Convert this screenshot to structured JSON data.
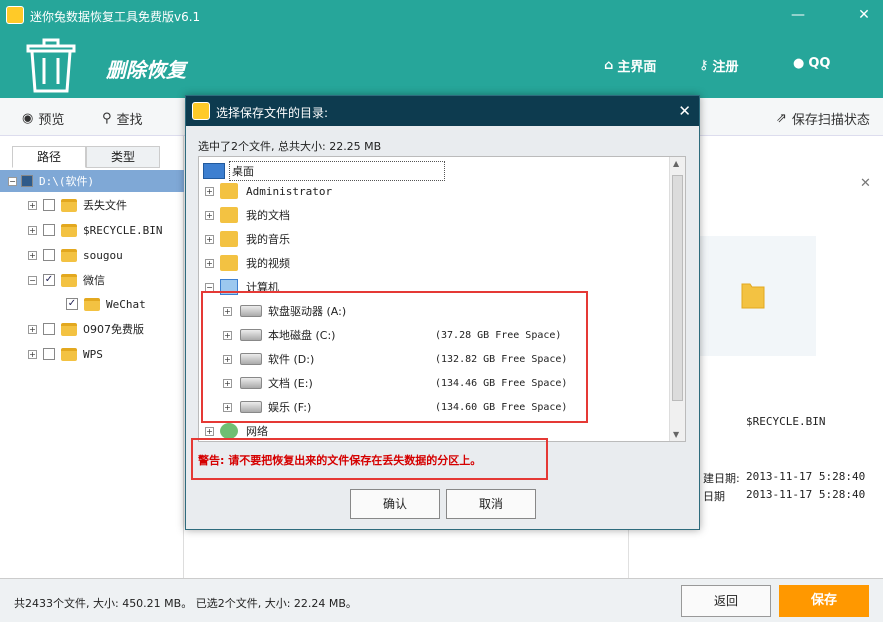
{
  "app": {
    "title": "迷你兔数据恢复工具免费版v6.1",
    "minimize": "—",
    "close": "✕"
  },
  "header": {
    "mode": "删除恢复",
    "nav": [
      {
        "label": "主界面",
        "icon": "home-icon"
      },
      {
        "label": "注册",
        "icon": "key-icon"
      },
      {
        "label": "QQ",
        "icon": "qq-icon"
      }
    ]
  },
  "toolbar": {
    "preview": "预览",
    "search": "查找",
    "save_scan": "保存扫描状态"
  },
  "left_panel": {
    "tabs": [
      "路径",
      "类型"
    ],
    "tree": [
      {
        "label": "D:\\(软件)",
        "checked": "■",
        "selected": true,
        "level": 0
      },
      {
        "label": "丢失文件",
        "checked": "",
        "level": 1
      },
      {
        "label": "$RECYCLE.BIN",
        "checked": "",
        "level": 1
      },
      {
        "label": "sougou",
        "checked": "",
        "level": 1
      },
      {
        "label": "微信",
        "checked": "✓",
        "level": 1
      },
      {
        "label": "WeChat",
        "checked": "✓",
        "level": 2
      },
      {
        "label": "0907免费版",
        "checked": "",
        "level": 1
      },
      {
        "label": "WPS",
        "checked": "",
        "level": 1
      }
    ]
  },
  "right_panel": {
    "close": "✕",
    "file_name": "$RECYCLE.BIN",
    "created_label": "建日期:",
    "created_value": "2013-11-17 5:28:40",
    "modified_label": "日期",
    "modified_value": "2013-11-17 5:28:40"
  },
  "status": {
    "summary": "共2433个文件, 大小: 450.21 MB。 已选2个文件, 大小: 22.24 MB。",
    "back": "返回",
    "save": "保存"
  },
  "dialog": {
    "title": "选择保存文件的目录:",
    "close": "✕",
    "info": "选中了2个文件, 总共大小: 22.25 MB",
    "desktop": "桌面",
    "items": [
      {
        "label": "Administrator"
      },
      {
        "label": "我的文档"
      },
      {
        "label": "我的音乐"
      },
      {
        "label": "我的视频"
      },
      {
        "label": "计算机"
      }
    ],
    "drives": [
      {
        "label": "软盘驱动器 (A:)",
        "size": ""
      },
      {
        "label": "本地磁盘 (C:)",
        "size": "(37.28 GB Free Space)"
      },
      {
        "label": "软件 (D:)",
        "size": "(132.82 GB Free Space)"
      },
      {
        "label": "文档 (E:)",
        "size": "(134.46 GB Free Space)"
      },
      {
        "label": "娱乐 (F:)",
        "size": "(134.60 GB Free Space)"
      }
    ],
    "network": "网络",
    "warning": "警告: 请不要把恢复出来的文件保存在丢失数据的分区上。",
    "ok": "确认",
    "cancel": "取消"
  }
}
